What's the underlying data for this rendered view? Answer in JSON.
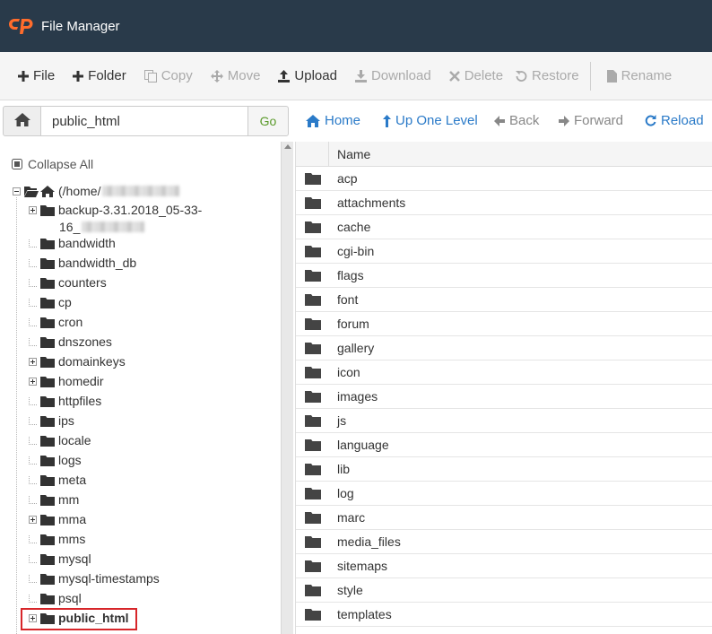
{
  "header": {
    "title": "File Manager"
  },
  "toolbar": {
    "file": "File",
    "folder": "Folder",
    "copy": "Copy",
    "move": "Move",
    "upload": "Upload",
    "download": "Download",
    "delete": "Delete",
    "restore": "Restore",
    "rename": "Rename"
  },
  "pathbar": {
    "path_value": "public_html",
    "go": "Go",
    "home": "Home",
    "up_one_level": "Up One Level",
    "back": "Back",
    "forward": "Forward",
    "reload": "Reload"
  },
  "sidebar": {
    "collapse_all": "Collapse All",
    "root_label": "(/home/",
    "items": [
      {
        "label": "backup-3.31.2018_05-33-",
        "label_line2": "16_",
        "expandable": true
      },
      {
        "label": "bandwidth",
        "expandable": false
      },
      {
        "label": "bandwidth_db",
        "expandable": false
      },
      {
        "label": "counters",
        "expandable": false
      },
      {
        "label": "cp",
        "expandable": false
      },
      {
        "label": "cron",
        "expandable": false
      },
      {
        "label": "dnszones",
        "expandable": false
      },
      {
        "label": "domainkeys",
        "expandable": true
      },
      {
        "label": "homedir",
        "expandable": true
      },
      {
        "label": "httpfiles",
        "expandable": false
      },
      {
        "label": "ips",
        "expandable": false
      },
      {
        "label": "locale",
        "expandable": false
      },
      {
        "label": "logs",
        "expandable": false
      },
      {
        "label": "meta",
        "expandable": false
      },
      {
        "label": "mm",
        "expandable": false
      },
      {
        "label": "mma",
        "expandable": true
      },
      {
        "label": "mms",
        "expandable": false
      },
      {
        "label": "mysql",
        "expandable": false
      },
      {
        "label": "mysql-timestamps",
        "expandable": false
      },
      {
        "label": "psql",
        "expandable": false
      },
      {
        "label": "public_html",
        "expandable": true,
        "selected": true
      }
    ]
  },
  "filetable": {
    "header_name": "Name",
    "rows": [
      "acp",
      "attachments",
      "cache",
      "cgi-bin",
      "flags",
      "font",
      "forum",
      "gallery",
      "icon",
      "images",
      "js",
      "language",
      "lib",
      "log",
      "marc",
      "media_files",
      "sitemaps",
      "style",
      "templates"
    ]
  },
  "colors": {
    "header_bg": "#293a4a",
    "link": "#2a7ac8",
    "highlight": "#d7262a",
    "logo": "#ff6c2c"
  }
}
